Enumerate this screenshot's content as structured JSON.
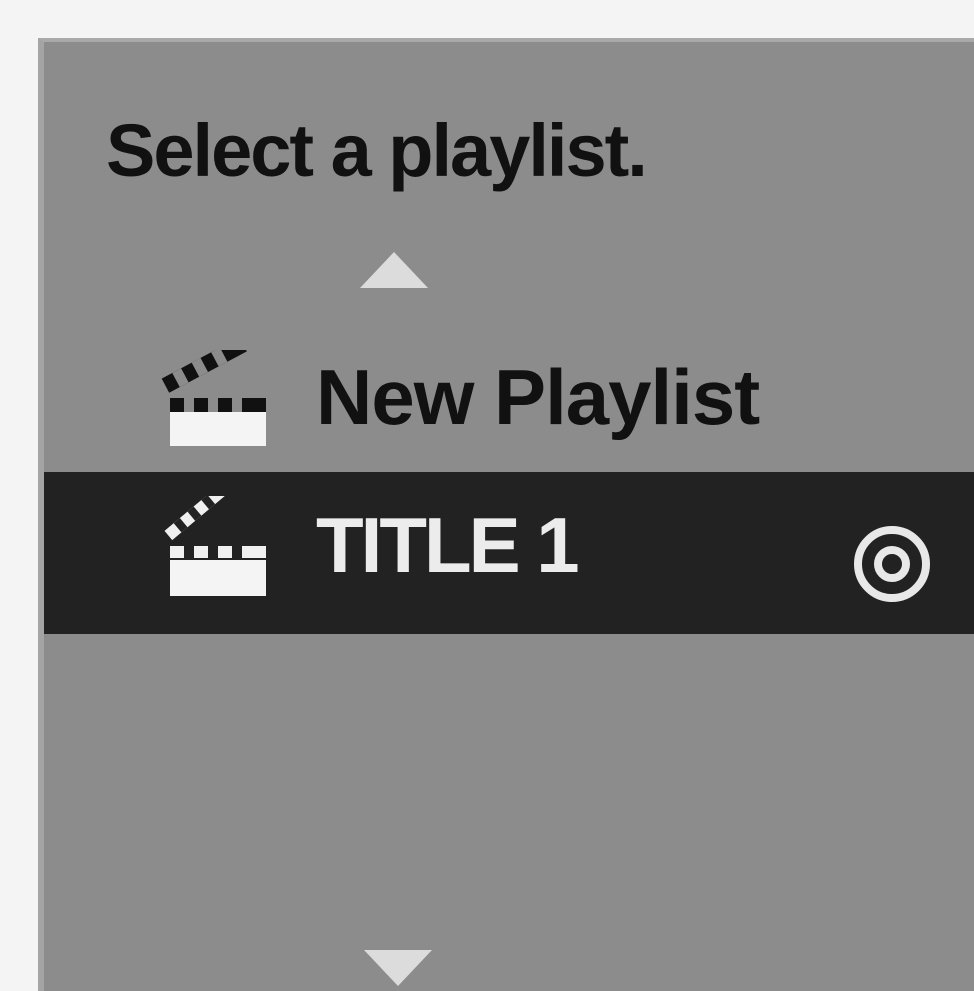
{
  "dialog": {
    "heading": "Select a playlist.",
    "scroll_up_icon": "triangle-up",
    "scroll_down_icon": "triangle-down"
  },
  "playlist_items": [
    {
      "icon": "clapperboard-icon",
      "label": "New Playlist",
      "selected": false
    },
    {
      "icon": "clapperboard-icon",
      "label": "TITLE 1",
      "selected": true,
      "trailing_icon": "disc-icon"
    }
  ],
  "colors": {
    "panel_background": "#8c8c8c",
    "selected_row": "#222222",
    "selected_text": "#ececec",
    "text": "#111111",
    "arrow": "#dcdcdc"
  }
}
